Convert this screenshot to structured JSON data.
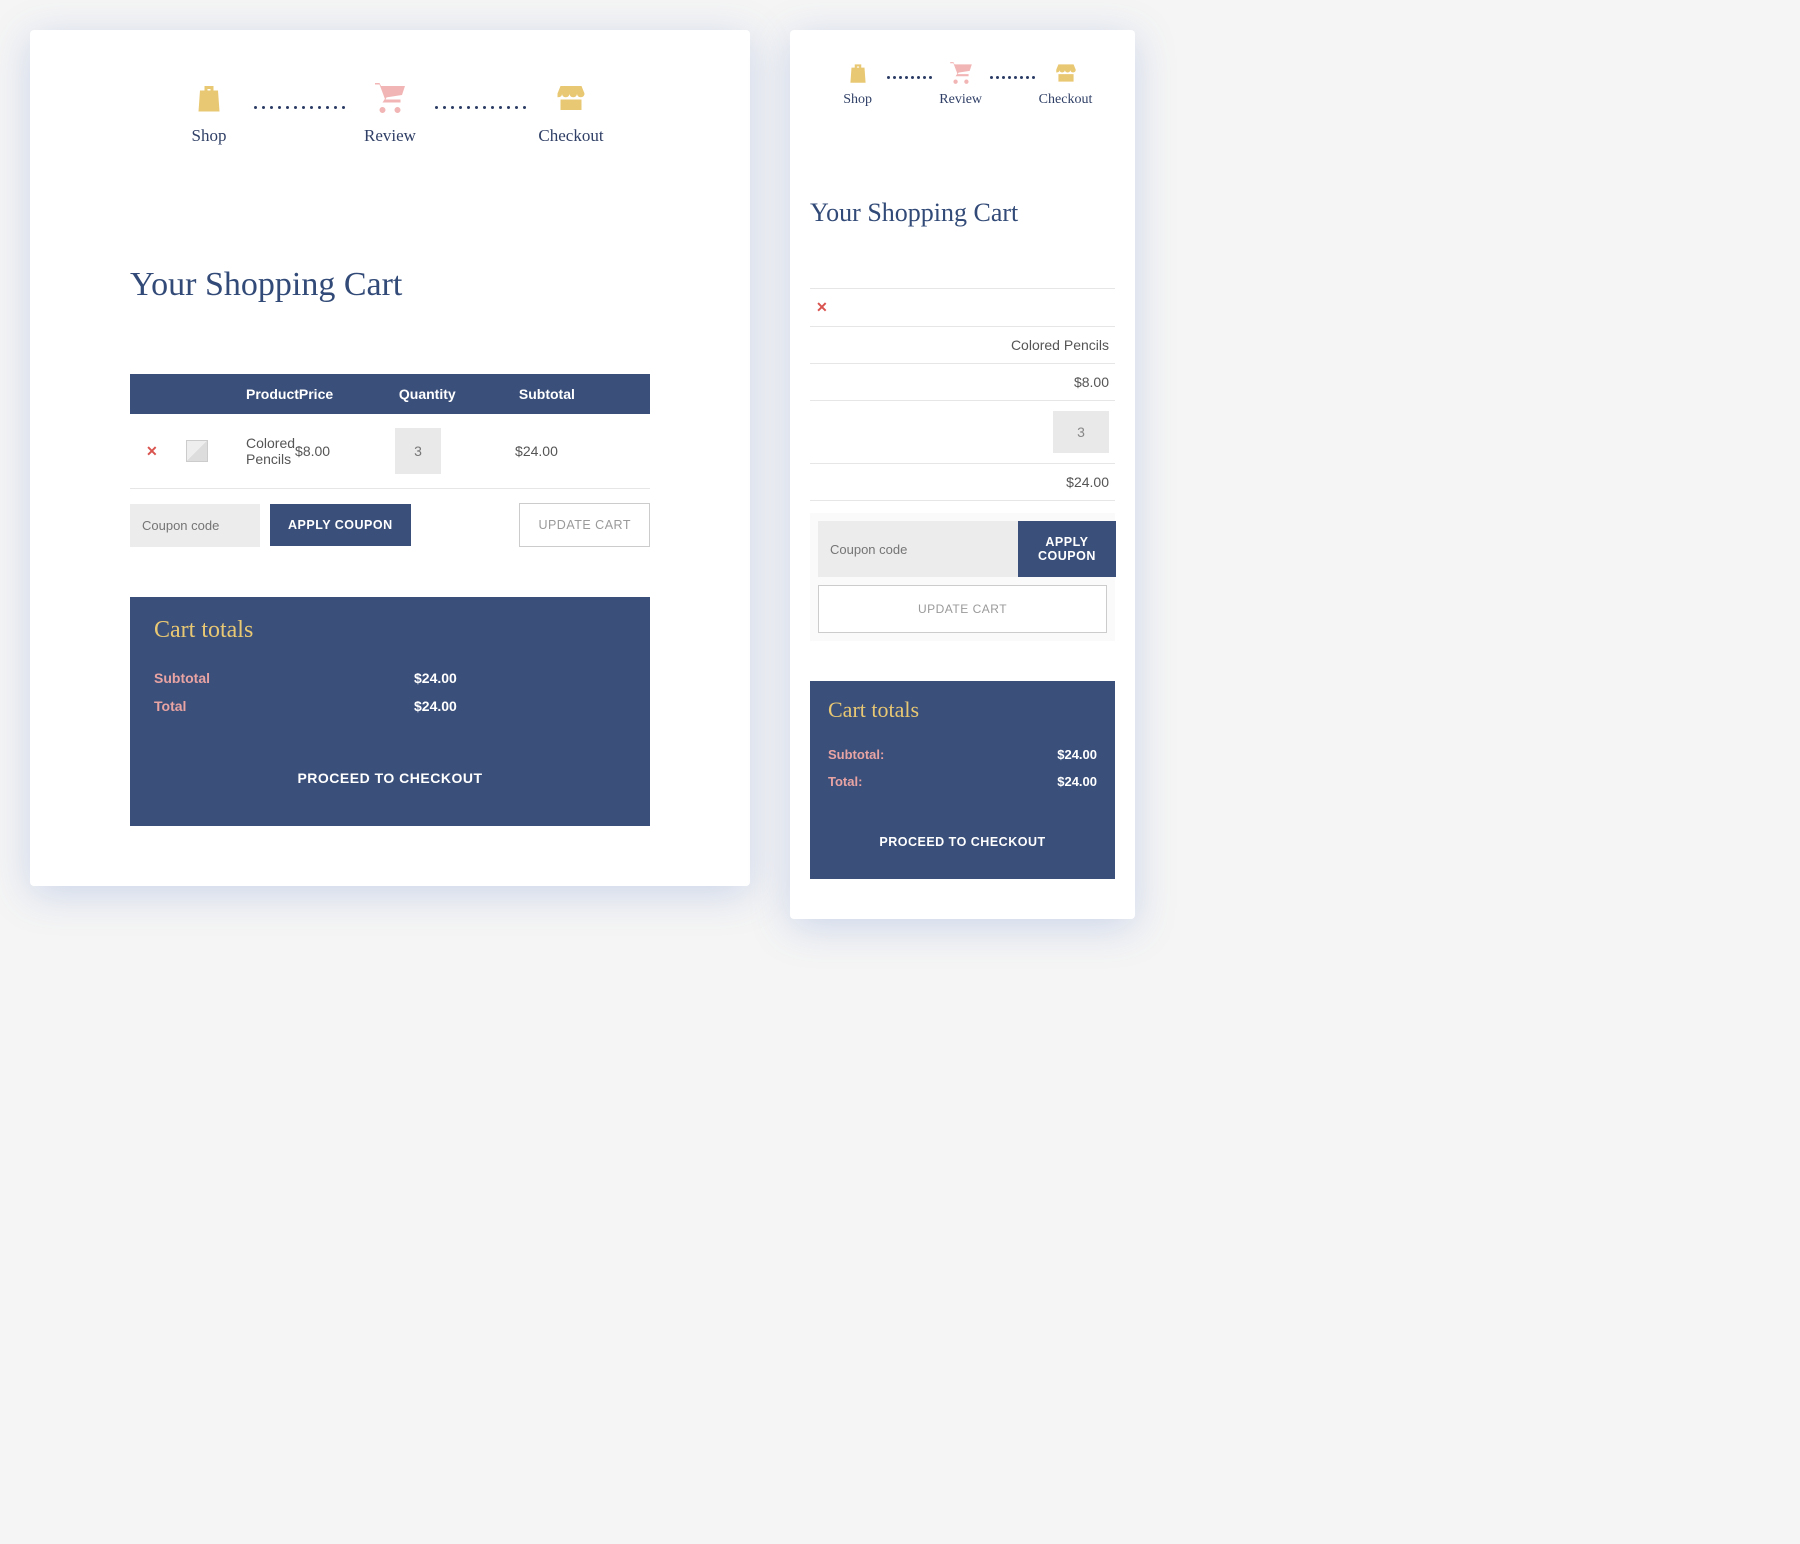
{
  "stepper": {
    "steps": [
      {
        "label": "Shop"
      },
      {
        "label": "Review"
      },
      {
        "label": "Checkout"
      }
    ]
  },
  "title": "Your Shopping Cart",
  "table": {
    "headers": {
      "product": "Product",
      "price": "Price",
      "quantity": "Quantity",
      "subtotal": "Subtotal"
    },
    "row": {
      "name": "Colored Pencils",
      "price": "$8.00",
      "qty": "3",
      "subtotal": "$24.00"
    }
  },
  "coupon": {
    "placeholder": "Coupon code",
    "apply": "APPLY COUPON",
    "update": "UPDATE CART"
  },
  "totals": {
    "title": "Cart totals",
    "subtotal_label": "Subtotal",
    "subtotal_label_m": "Subtotal:",
    "subtotal_value": "$24.00",
    "total_label": "Total",
    "total_label_m": "Total:",
    "total_value": "$24.00",
    "checkout": "PROCEED TO CHECKOUT"
  },
  "mobile_rows": {
    "name": "Colored Pencils",
    "price": "$8.00",
    "qty": "3",
    "subtotal": "$24.00"
  }
}
